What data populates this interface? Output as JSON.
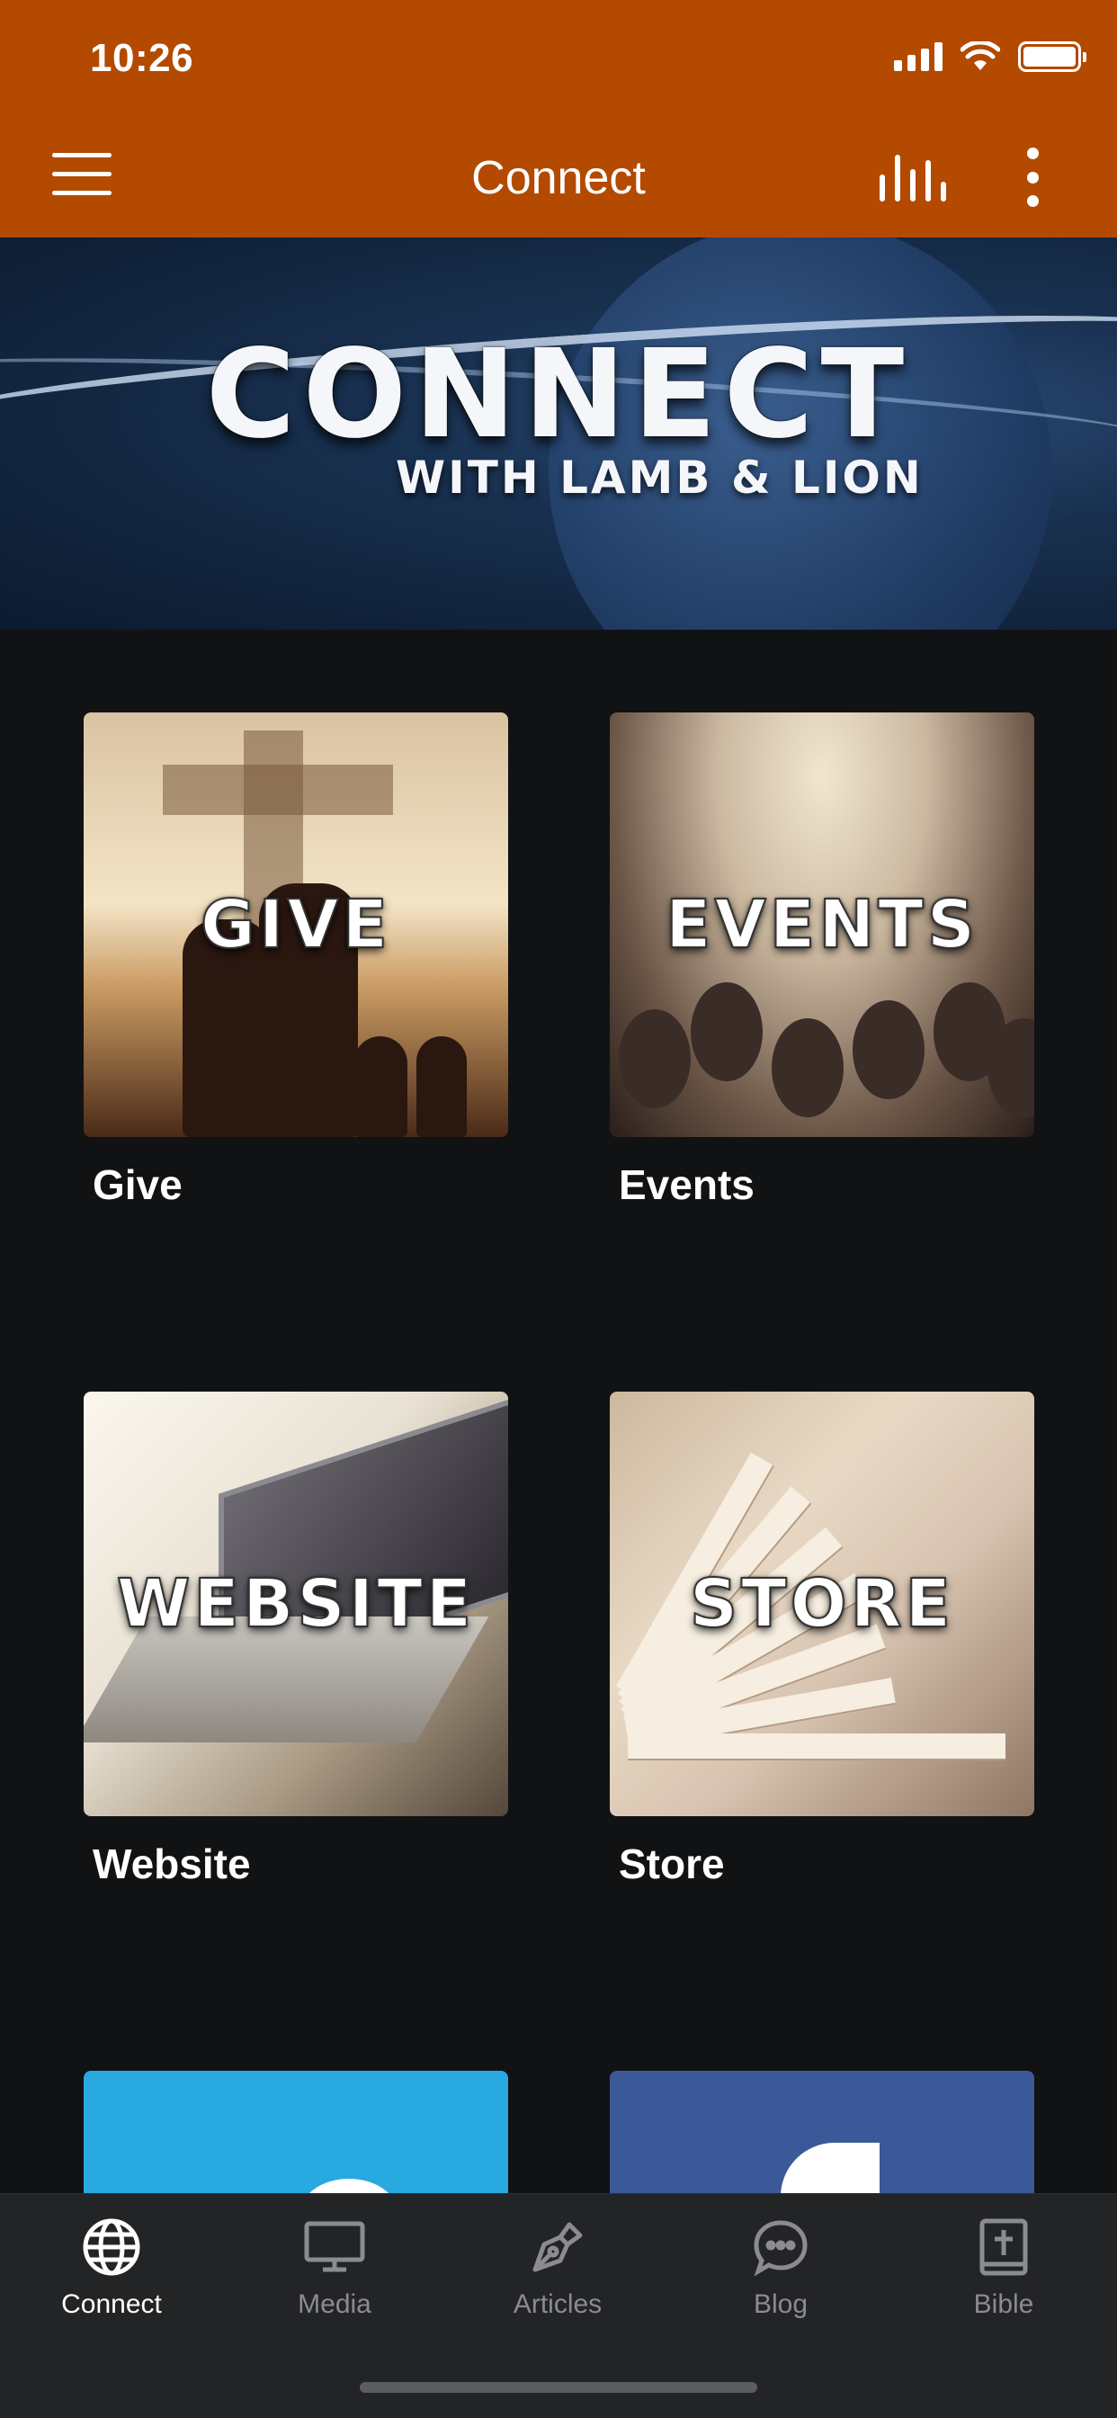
{
  "status_bar": {
    "time": "10:26"
  },
  "nav": {
    "title": "Connect"
  },
  "banner": {
    "title": "CONNECT",
    "subtitle": "WITH LAMB & LION"
  },
  "tiles": [
    {
      "overlay": "GIVE",
      "label": "Give"
    },
    {
      "overlay": "EVENTS",
      "label": "Events"
    },
    {
      "overlay": "WEBSITE",
      "label": "Website"
    },
    {
      "overlay": "STORE",
      "label": "Store"
    },
    {
      "overlay": "",
      "label": "",
      "icon": "twitter-icon",
      "color": "#28a9e0"
    },
    {
      "overlay": "",
      "label": "",
      "icon": "facebook-icon",
      "color": "#3b5998"
    }
  ],
  "tabbar": {
    "tabs": [
      {
        "label": "Connect",
        "icon": "globe-icon",
        "active": true
      },
      {
        "label": "Media",
        "icon": "monitor-icon",
        "active": false
      },
      {
        "label": "Articles",
        "icon": "pen-nib-icon",
        "active": false
      },
      {
        "label": "Blog",
        "icon": "chat-bubble-icon",
        "active": false
      },
      {
        "label": "Bible",
        "icon": "bible-icon",
        "active": false
      }
    ]
  },
  "colors": {
    "accent": "#b34a00",
    "background": "#111214",
    "tabbar": "#232426",
    "inactive": "#8b8c90"
  }
}
